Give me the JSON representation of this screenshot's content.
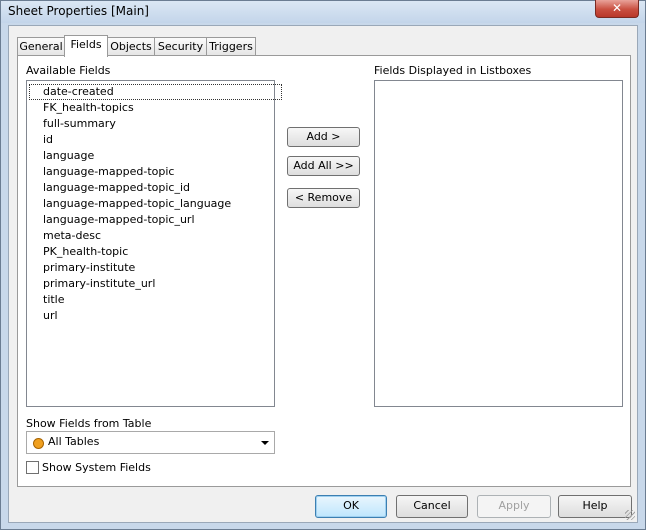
{
  "window": {
    "title": "Sheet Properties [Main]",
    "close_glyph": "✕"
  },
  "tabs": [
    {
      "label": "General"
    },
    {
      "label": "Fields"
    },
    {
      "label": "Objects"
    },
    {
      "label": "Security"
    },
    {
      "label": "Triggers"
    }
  ],
  "active_tab": "Fields",
  "available": {
    "label": "Available Fields",
    "items": [
      "date-created",
      "FK_health-topics",
      "full-summary",
      "id",
      "language",
      "language-mapped-topic",
      "language-mapped-topic_id",
      "language-mapped-topic_language",
      "language-mapped-topic_url",
      "meta-desc",
      "PK_health-topic",
      "primary-institute",
      "primary-institute_url",
      "title",
      "url"
    ]
  },
  "displayed": {
    "label": "Fields Displayed in Listboxes",
    "items": []
  },
  "move_buttons": {
    "add": "Add >",
    "add_all": "Add All >>",
    "remove": "< Remove"
  },
  "show_from_table": {
    "label": "Show Fields from Table",
    "value": "All Tables",
    "dot_color": "#f0a020"
  },
  "show_system_fields": {
    "label": "Show System Fields",
    "checked": false
  },
  "footer": {
    "ok": "OK",
    "cancel": "Cancel",
    "apply": "Apply",
    "help": "Help"
  }
}
